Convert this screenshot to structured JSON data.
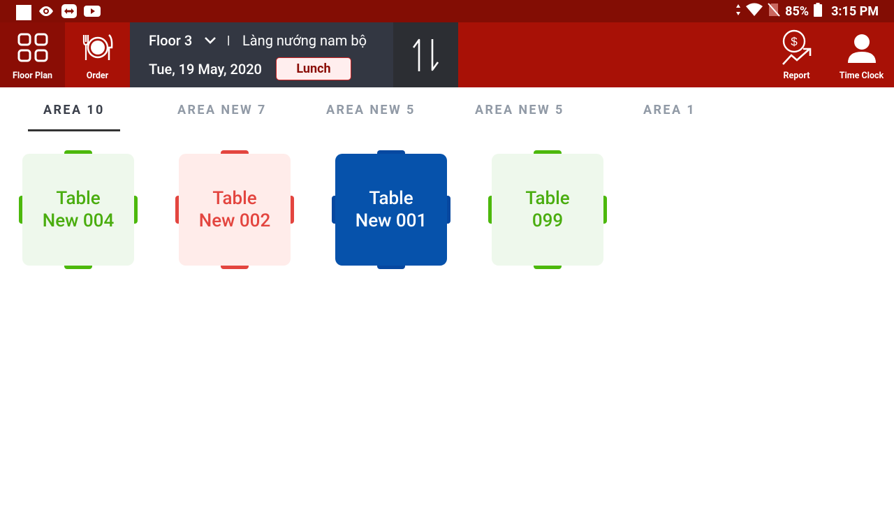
{
  "status_bar": {
    "battery": "85%",
    "time": "3:15 PM"
  },
  "app_bar": {
    "floor_plan_label": "Floor Plan",
    "order_label": "Order",
    "floor_name": "Floor 3",
    "separator": "|",
    "restaurant_name": "Làng nướng nam bộ",
    "date": "Tue, 19 May, 2020",
    "meal_period": "Lunch",
    "report_label": "Report",
    "time_clock_label": "Time Clock"
  },
  "tabs": [
    {
      "label": "AREA 10",
      "active": true
    },
    {
      "label": "AREA NEW 7",
      "active": false
    },
    {
      "label": "AREA NEW 5",
      "active": false
    },
    {
      "label": "AREA NEW 5",
      "active": false
    },
    {
      "label": "AREA 1",
      "active": false
    }
  ],
  "tables": [
    {
      "line1": "Table",
      "line2": "New 004",
      "status": "available"
    },
    {
      "line1": "Table",
      "line2": "New 002",
      "status": "occupied"
    },
    {
      "line1": "Table",
      "line2": "New 001",
      "status": "selected"
    },
    {
      "line1": "Table",
      "line2": "099",
      "status": "available"
    }
  ],
  "colors": {
    "app_bar": "#a81106",
    "status_bar": "#830d04",
    "available": "#4cb80c",
    "occupied": "#e3453f",
    "selected": "#0652ab"
  }
}
